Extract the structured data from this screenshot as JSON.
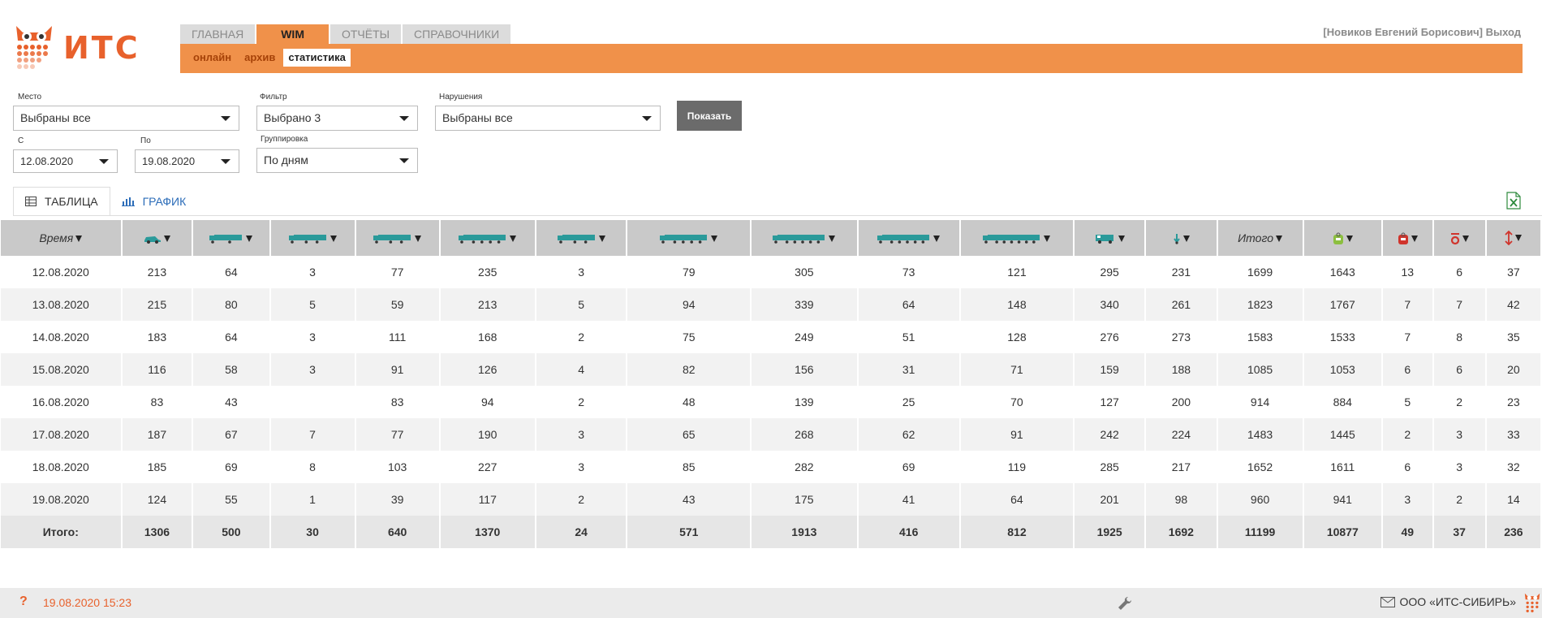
{
  "logo": {
    "text": "ИТС"
  },
  "nav": {
    "tabs": [
      {
        "label": "ГЛАВНАЯ"
      },
      {
        "label": "WIM"
      },
      {
        "label": "ОТЧЁТЫ"
      },
      {
        "label": "СПРАВОЧНИКИ"
      }
    ],
    "active": "WIM"
  },
  "subnav": {
    "items": [
      {
        "label": "онлайн"
      },
      {
        "label": "архив"
      },
      {
        "label": "статистика"
      }
    ],
    "active": "статистика"
  },
  "user": {
    "name": "[Новиков Евгений Борисович]",
    "logout": "Выход"
  },
  "filters": {
    "place": {
      "label": "Место",
      "value": "Выбраны все"
    },
    "filter": {
      "label": "Фильтр",
      "value": "Выбрано 3"
    },
    "violations": {
      "label": "Нарушения",
      "value": "Выбраны все"
    },
    "from": {
      "label": "С",
      "value": "12.08.2020"
    },
    "to": {
      "label": "По",
      "value": "19.08.2020"
    },
    "grouping": {
      "label": "Группировка",
      "value": "По дням"
    },
    "show_button": "Показать"
  },
  "view_tabs": {
    "table": "ТАБЛИЦА",
    "chart": "ГРАФИК"
  },
  "table": {
    "columns": [
      {
        "label": "Время",
        "icon": "time"
      },
      {
        "label": "",
        "icon": "car-icon"
      },
      {
        "label": "",
        "icon": "truck-2-axle-icon"
      },
      {
        "label": "",
        "icon": "truck-3-axle-icon"
      },
      {
        "label": "",
        "icon": "truck-4-axle-icon"
      },
      {
        "label": "",
        "icon": "truck-5-axle-icon"
      },
      {
        "label": "",
        "icon": "truck-trailer-2-icon"
      },
      {
        "label": "",
        "icon": "truck-trailer-3-icon"
      },
      {
        "label": "",
        "icon": "truck-trailer-4-icon"
      },
      {
        "label": "",
        "icon": "truck-trailer-5-icon"
      },
      {
        "label": "",
        "icon": "truck-trailer-6-icon"
      },
      {
        "label": "",
        "icon": "bus-icon"
      },
      {
        "label": "",
        "icon": "unknown-vehicle-icon"
      },
      {
        "label": "Итого",
        "icon": "total"
      },
      {
        "label": "",
        "icon": "weight-ok-icon"
      },
      {
        "label": "",
        "icon": "weight-overload-icon"
      },
      {
        "label": "",
        "icon": "axle-overload-icon"
      },
      {
        "label": "",
        "icon": "height-overload-icon"
      }
    ],
    "rows": [
      [
        "12.08.2020",
        "213",
        "64",
        "3",
        "77",
        "235",
        "3",
        "79",
        "305",
        "73",
        "121",
        "295",
        "231",
        "1699",
        "1643",
        "13",
        "6",
        "37"
      ],
      [
        "13.08.2020",
        "215",
        "80",
        "5",
        "59",
        "213",
        "5",
        "94",
        "339",
        "64",
        "148",
        "340",
        "261",
        "1823",
        "1767",
        "7",
        "7",
        "42"
      ],
      [
        "14.08.2020",
        "183",
        "64",
        "3",
        "111",
        "168",
        "2",
        "75",
        "249",
        "51",
        "128",
        "276",
        "273",
        "1583",
        "1533",
        "7",
        "8",
        "35"
      ],
      [
        "15.08.2020",
        "116",
        "58",
        "3",
        "91",
        "126",
        "4",
        "82",
        "156",
        "31",
        "71",
        "159",
        "188",
        "1085",
        "1053",
        "6",
        "6",
        "20"
      ],
      [
        "16.08.2020",
        "83",
        "43",
        "",
        "83",
        "94",
        "2",
        "48",
        "139",
        "25",
        "70",
        "127",
        "200",
        "914",
        "884",
        "5",
        "2",
        "23"
      ],
      [
        "17.08.2020",
        "187",
        "67",
        "7",
        "77",
        "190",
        "3",
        "65",
        "268",
        "62",
        "91",
        "242",
        "224",
        "1483",
        "1445",
        "2",
        "3",
        "33"
      ],
      [
        "18.08.2020",
        "185",
        "69",
        "8",
        "103",
        "227",
        "3",
        "85",
        "282",
        "69",
        "119",
        "285",
        "217",
        "1652",
        "1611",
        "6",
        "3",
        "32"
      ],
      [
        "19.08.2020",
        "124",
        "55",
        "1",
        "39",
        "117",
        "2",
        "43",
        "175",
        "41",
        "64",
        "201",
        "98",
        "960",
        "941",
        "3",
        "2",
        "14"
      ]
    ],
    "total": [
      "Итого:",
      "1306",
      "500",
      "30",
      "640",
      "1370",
      "24",
      "571",
      "1913",
      "416",
      "812",
      "1925",
      "1692",
      "11199",
      "10877",
      "49",
      "37",
      "236"
    ]
  },
  "footer": {
    "datetime": "19.08.2020 15:23",
    "org": "ООО «ИТС-СИБИРЬ»"
  },
  "colors": {
    "accent": "#f0914a",
    "brand": "#e8612c",
    "truck": "#2a9a9a"
  }
}
